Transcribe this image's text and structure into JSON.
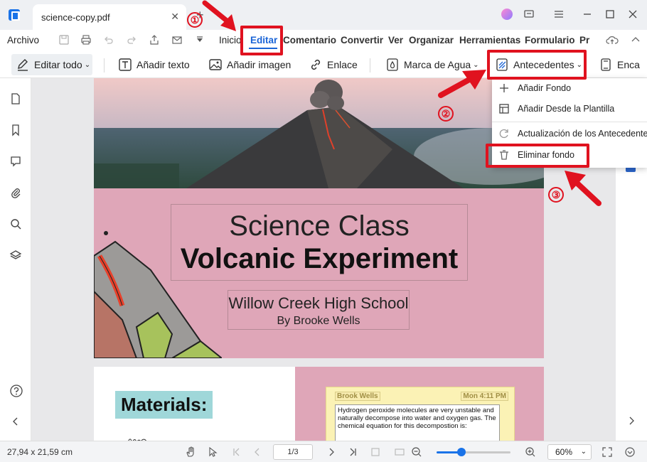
{
  "window": {
    "tab_title": "science-copy.pdf",
    "close_tab": "✕",
    "new_tab": "+"
  },
  "menu": {
    "file": "Archivo",
    "items": [
      "Inicio",
      "Editar",
      "Comentario",
      "Convertir",
      "Ver",
      "Organizar",
      "Herramientas",
      "Formulario",
      "Pr"
    ],
    "active": "Editar"
  },
  "toolbar": {
    "edit_all": "Editar todo",
    "add_text": "Añadir texto",
    "add_image": "Añadir imagen",
    "link": "Enlace",
    "watermark": "Marca de Agua",
    "background": "Antecedentes",
    "header_footer": "Enca"
  },
  "dropdown": {
    "add_background": "Añadir Fondo",
    "add_from_template": "Añadir Desde la Plantilla",
    "update_background": "Actualización de los Antecedentes",
    "remove_background": "Eliminar fondo"
  },
  "annotations": {
    "step1": "①",
    "step2": "②",
    "step3": "③",
    "color": "#e0121f"
  },
  "page1": {
    "title_line1": "Science Class",
    "title_line2": "Volcanic Experiment",
    "school": "Willow Creek High School",
    "author": "By Brooke Wells"
  },
  "page2": {
    "materials": "Materials:",
    "note_author": "Brook Wells",
    "note_time": "Mon 4:11 PM",
    "note_text": "Hydrogen peroxide molecules are very unstable and naturally decompose into water and oxygen gas. The chemical equation for this decompostion is:"
  },
  "status": {
    "page_dims": "27,94 x 21,59 cm",
    "page_indicator": "1/3",
    "zoom": "60%",
    "zoom_fraction": 0.34
  },
  "colors": {
    "accent": "#1a64d6",
    "page_pink": "#dfa6b8",
    "materials_bg": "#9fd7d9"
  }
}
